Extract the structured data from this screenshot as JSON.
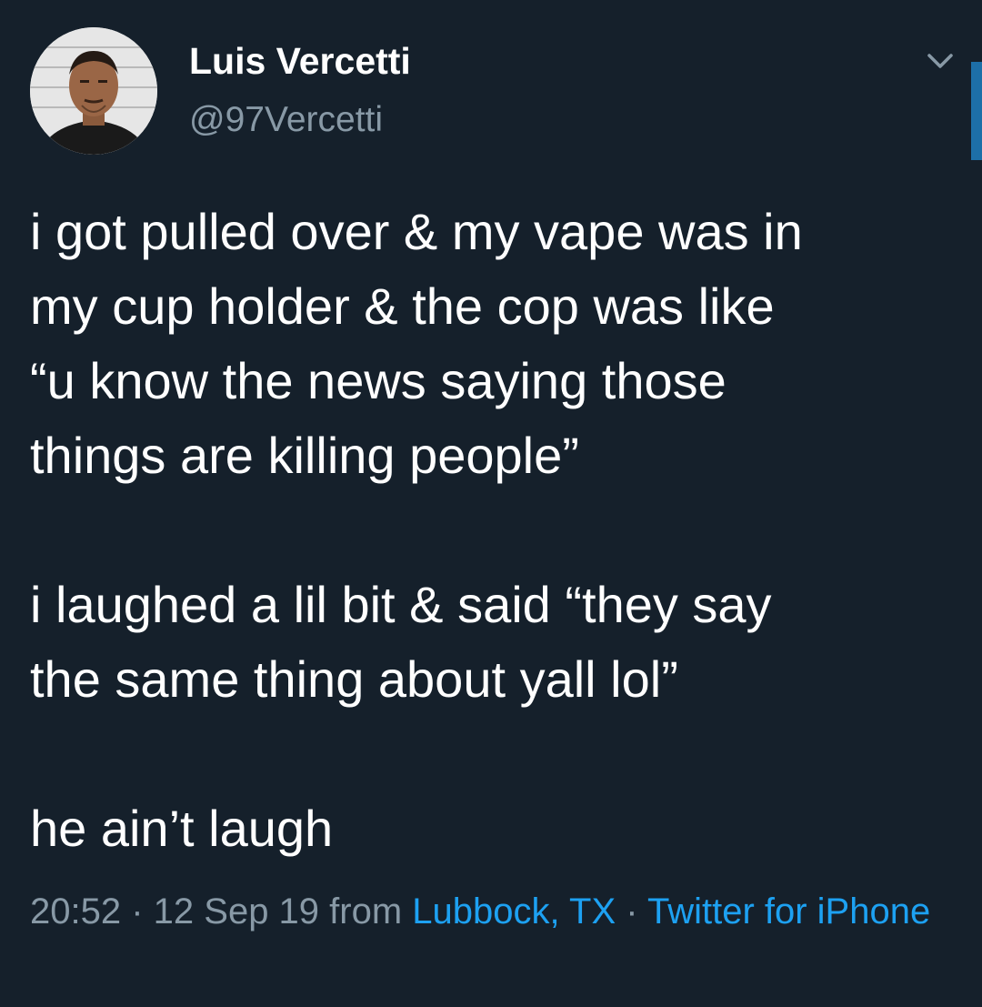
{
  "author": {
    "display_name": "Luis Vercetti",
    "handle": "@97Vercetti",
    "avatar_icon": "profile-photo",
    "menu_icon": "chevron-down-icon"
  },
  "tweet": {
    "paragraphs": [
      "i got pulled over & my vape was in\nmy cup holder & the cop was like\n“u know the news saying those\nthings are killing people”",
      "i laughed a lil bit & said “they say\nthe same thing about yall lol”",
      "he ain’t laugh"
    ]
  },
  "meta": {
    "time": "20:52",
    "separator": " · ",
    "date": "12 Sep 19",
    "from_text": " from ",
    "location": "Lubbock, TX",
    "source": "Twitter for iPhone"
  },
  "colors": {
    "background": "#15202b",
    "text": "#ffffff",
    "secondary": "#8899a6",
    "link": "#1da1f2"
  }
}
